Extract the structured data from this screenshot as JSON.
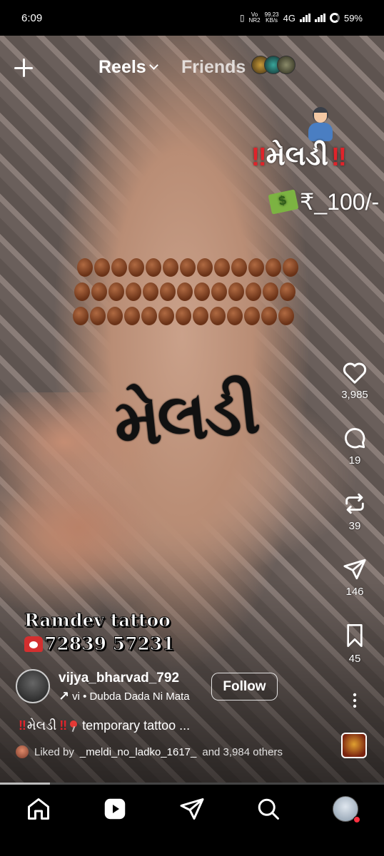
{
  "status": {
    "time": "6:09",
    "vo_line1": "Vo",
    "vo_line2": "NR2",
    "speed_line1": "99.23",
    "speed_line2": "KB/s",
    "network": "4G",
    "battery": "59%"
  },
  "top_bar": {
    "reels_label": "Reels",
    "friends_label": "Friends"
  },
  "overlay": {
    "title_bang": "‼",
    "title_text": "મેલડી",
    "price": "₹_100/-"
  },
  "tattoo_text": "મેલડી",
  "actions": {
    "likes": "3,985",
    "comments": "19",
    "reposts": "39",
    "shares": "146",
    "saves": "45"
  },
  "shop": {
    "name": "Ramdev tattoo",
    "phone": "72839 57231"
  },
  "author": {
    "username": "vijya_bharvad_792",
    "audio_prefix": "↗",
    "audio_text": "vi • Dubda Dada Ni Mata",
    "follow_label": "Follow"
  },
  "caption": {
    "bang": "‼",
    "meldi": "મેલડી",
    "text": "temporary tattoo ..."
  },
  "liked_by": {
    "prefix": "Liked by",
    "user": "_meldi_no_ladko_1617_",
    "suffix": "and 3,984 others"
  },
  "progress": 0.13,
  "colors": {
    "accent_red": "#e0232a",
    "notification": "#ff3040"
  }
}
